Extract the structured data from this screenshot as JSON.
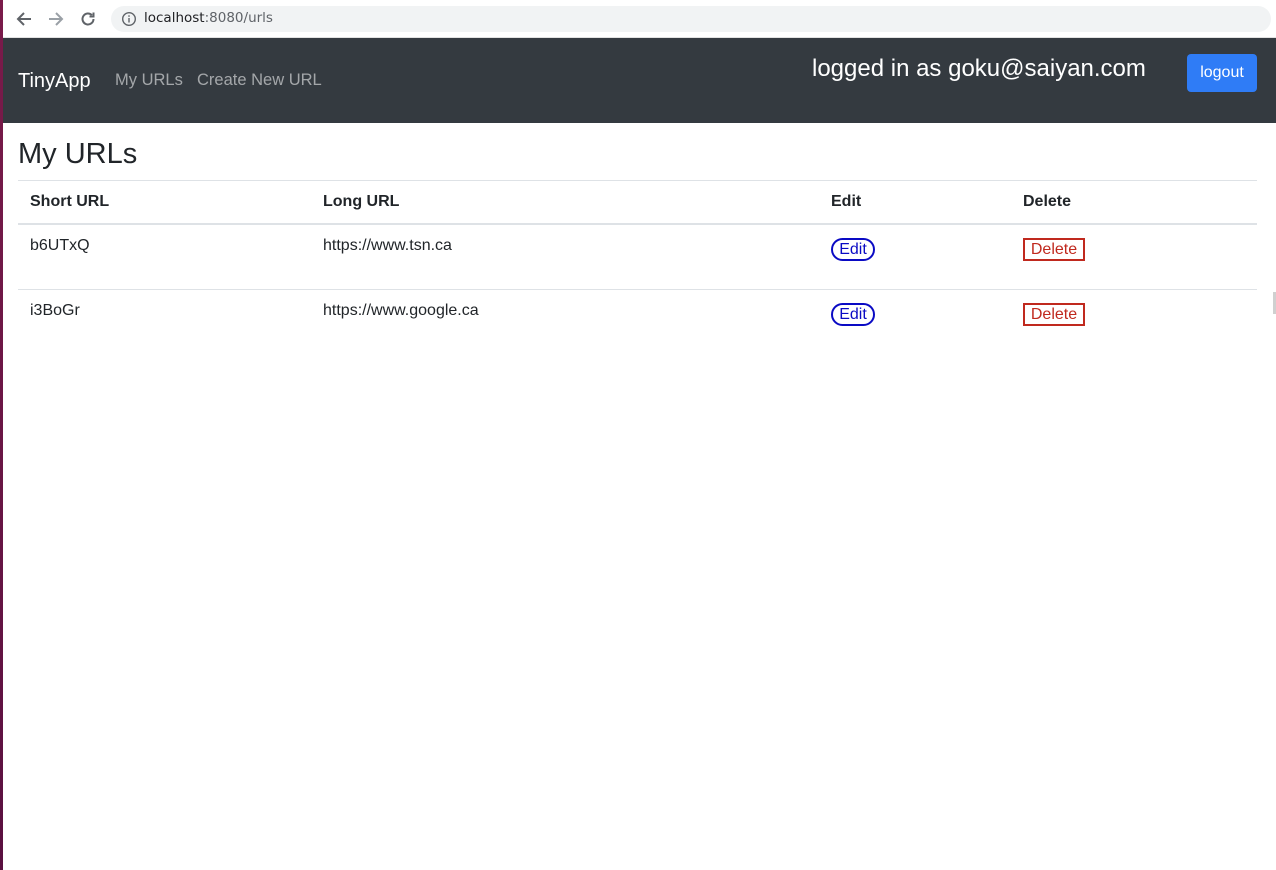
{
  "browser": {
    "url_host": "localhost",
    "url_rest": ":8080/urls"
  },
  "navbar": {
    "brand": "TinyApp",
    "links": [
      "My URLs",
      "Create New URL"
    ],
    "logged_in_text": "logged in as goku@saiyan.com",
    "logout_label": "logout"
  },
  "main": {
    "title": "My URLs",
    "table": {
      "headers": [
        "Short URL",
        "Long URL",
        "Edit",
        "Delete"
      ],
      "rows": [
        {
          "short": "b6UTxQ",
          "long": "https://www.tsn.ca",
          "edit": "Edit",
          "delete": "Delete"
        },
        {
          "short": "i3BoGr",
          "long": "https://www.google.ca",
          "edit": "Edit",
          "delete": "Delete"
        }
      ]
    }
  },
  "colors": {
    "navbar_bg": "#343a40",
    "logout_bg": "#2f7cf6",
    "edit_accent": "#0a0ac4",
    "delete_accent": "#c0291e"
  }
}
